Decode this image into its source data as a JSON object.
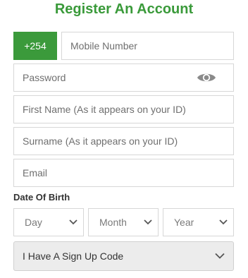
{
  "title": "Register An Account",
  "phone": {
    "prefix": "+254",
    "placeholder": "Mobile Number"
  },
  "password": {
    "placeholder": "Password"
  },
  "first_name": {
    "placeholder": "First Name (As it appears on your ID)"
  },
  "surname": {
    "placeholder": "Surname (As it appears on your ID)"
  },
  "email": {
    "placeholder": "Email"
  },
  "dob": {
    "label": "Date Of Birth",
    "day": "Day",
    "month": "Month",
    "year": "Year"
  },
  "signup_code": {
    "label": "I Have A Sign Up Code"
  },
  "colors": {
    "accent": "#3b9a3b",
    "title": "#3a9a3a",
    "border": "#d7d7d7"
  },
  "icons": [
    "eye-icon",
    "chevron-down-icon"
  ]
}
